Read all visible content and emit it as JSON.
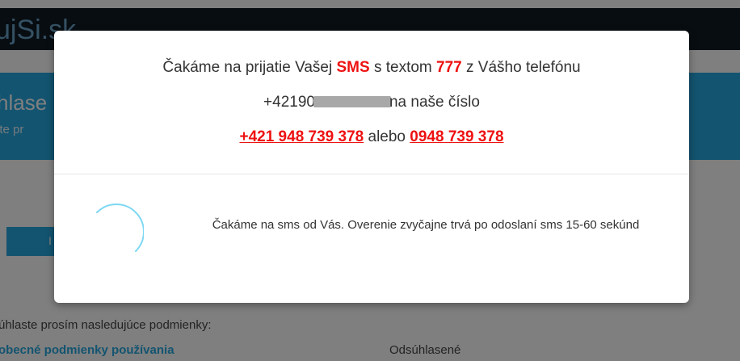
{
  "background": {
    "logo": "ujSi.sk",
    "hero_title": "hlase",
    "hero_subtitle": "ite pr",
    "bar_letter": "I",
    "consent_heading": "úhlaste prosím nasledujúce podmienky:",
    "terms_link": "obecné podmienky používania",
    "terms_status": "Odsúhlasené"
  },
  "modal": {
    "line1": {
      "prefix": "Čakáme na prijatie Vašej ",
      "sms": "SMS",
      "middle": " s textom ",
      "code": "777",
      "suffix": " z Vášho telefónu"
    },
    "line2": {
      "phone_visible": "+42190",
      "suffix": "na naše číslo"
    },
    "line3": {
      "number_international": "+421 948 739 378",
      "separator": " alebo ",
      "number_local": "0948 739 378"
    },
    "status": "Čakáme na sms od Vás. Overenie zvyčajne trvá po odoslaní sms 15-60 sekúnd"
  },
  "colors": {
    "accent_red": "#ee1111",
    "spinner": "#7fd8f2",
    "brand_blue": "#27a9e1"
  }
}
